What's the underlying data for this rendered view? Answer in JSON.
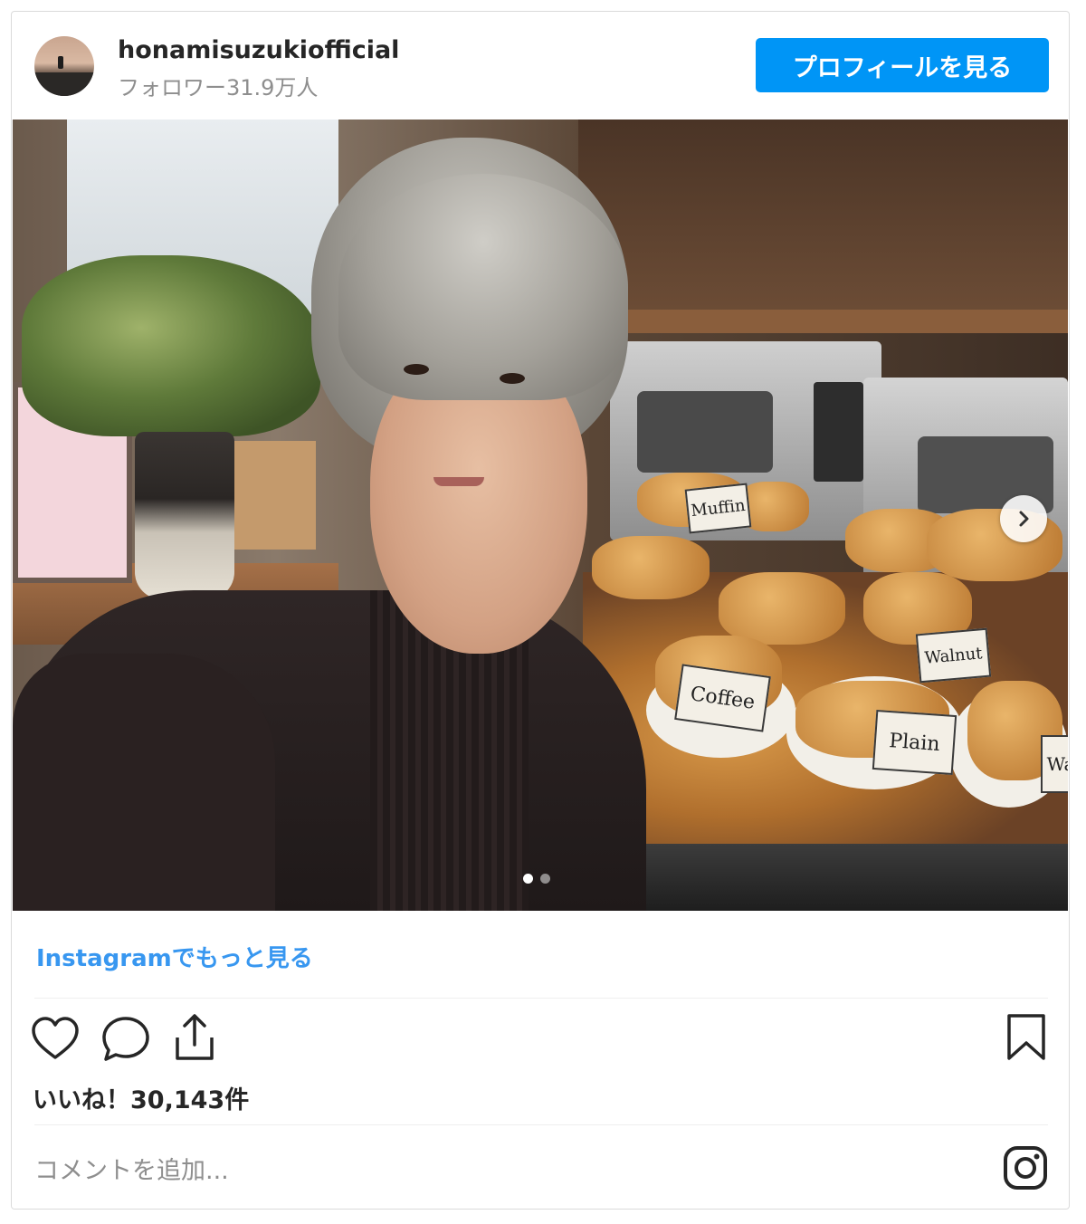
{
  "header": {
    "username": "honamisuzukiofficial",
    "followers": "フォロワー31.9万人",
    "profile_button": "プロフィールを見る"
  },
  "photo": {
    "signs": [
      "Muffin",
      "Coffee",
      "Plain",
      "Walnut",
      "Wa"
    ],
    "carousel": {
      "total": 2,
      "active": 1
    }
  },
  "footer": {
    "more_link": "Instagramでもっと見る",
    "likes": "いいね！30,143件",
    "comment_placeholder": "コメントを追加..."
  },
  "colors": {
    "accent": "#0095f6",
    "link": "#3897f0",
    "text": "#262626",
    "muted": "#8e8e8e"
  },
  "icons": [
    "heart-icon",
    "comment-icon",
    "share-icon",
    "bookmark-icon",
    "instagram-icon",
    "chevron-right-icon"
  ]
}
